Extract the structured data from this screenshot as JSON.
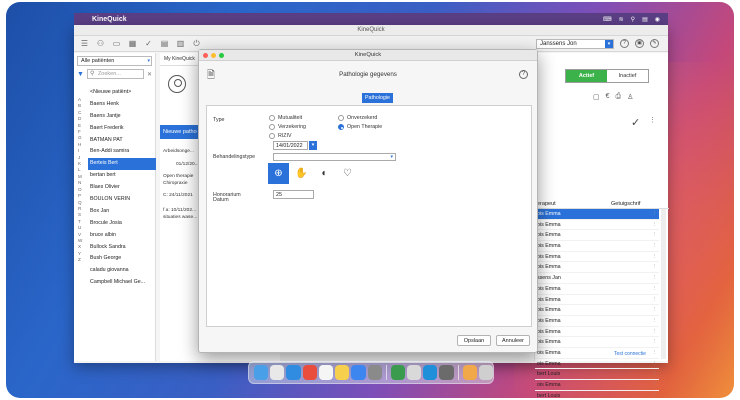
{
  "menubar": {
    "app_name": "KineQuick"
  },
  "mainwin": {
    "title": "KineQuick",
    "practitioner": "Janssens Jon",
    "sidebar": {
      "filter": "Alle patiënten",
      "search_placeholder": "Zoeken...",
      "letters": [
        "A",
        "B",
        "C",
        "D",
        "E",
        "F",
        "G",
        "H",
        "I",
        "J",
        "K",
        "L",
        "M",
        "N",
        "O",
        "P",
        "Q",
        "R",
        "S",
        "T",
        "U",
        "V",
        "W",
        "X",
        "Y",
        "Z"
      ],
      "patients": [
        "<Nieuwe patiënt>",
        "Baens Henk",
        "Baens Jantje",
        "Baert Frederik",
        "BATMAN PAT",
        "Ben-Addi samira",
        "Berteis Bert",
        "bertan bert",
        "Blaes Olivier",
        "BOULON VERIN",
        "Box Jan",
        "Brocule Josia",
        "bruce albin",
        "Bullock Sandra",
        "Bush George",
        "caladu giovanna",
        "Campbell Michael Ge..."
      ]
    },
    "center": {
      "tab": "My KineQuick",
      "new_path": "Nieuwe patho",
      "lines": [
        "Arbeidsonge...",
        "01/12/20...",
        "Open therapie",
        "Chiropraxie",
        "C: 24/11/2021",
        "f a: 10/11/202...",
        "situaties wase..."
      ]
    },
    "right": {
      "active_label": "Actief",
      "inactive_label": "Inactief",
      "col_therapist": "erapeut",
      "col_witness": "Getuigschrif",
      "rows": [
        "ois Emma",
        "ois Emma",
        "ois Emma",
        "ois Emma",
        "ois Emma",
        "ois Emma",
        "ssens Jan",
        "ois Emma",
        "ois Emma",
        "ois Emma",
        "ois Emma",
        "ois Emma",
        "ois Emma",
        "ois Emma",
        "ois Emma",
        "bert Louis",
        "ois Emma",
        "bert Louis"
      ],
      "status": "Test connectie"
    }
  },
  "dialog": {
    "title": "KineQuick",
    "header": "Pathologie gegevens",
    "tab": "Pathologie",
    "type_label": "Type",
    "radios": [
      {
        "label": "Mutualiteit",
        "checked": false
      },
      {
        "label": "Onverzekerd",
        "checked": false
      },
      {
        "label": "Verzekering",
        "checked": false
      },
      {
        "label": "Open Therapie",
        "checked": true
      },
      {
        "label": "RIZIV",
        "checked": false
      }
    ],
    "date_label": "Datum",
    "date_value": "14/01/2022",
    "treatment_label": "Behandelingstype",
    "treatment_value": "",
    "fee_label": "Honorarium",
    "fee_value": "25",
    "save_label": "Opslaan",
    "cancel_label": "Annuleer"
  },
  "colors": {
    "accent": "#2a72d9",
    "active_green": "#3cb34a"
  }
}
